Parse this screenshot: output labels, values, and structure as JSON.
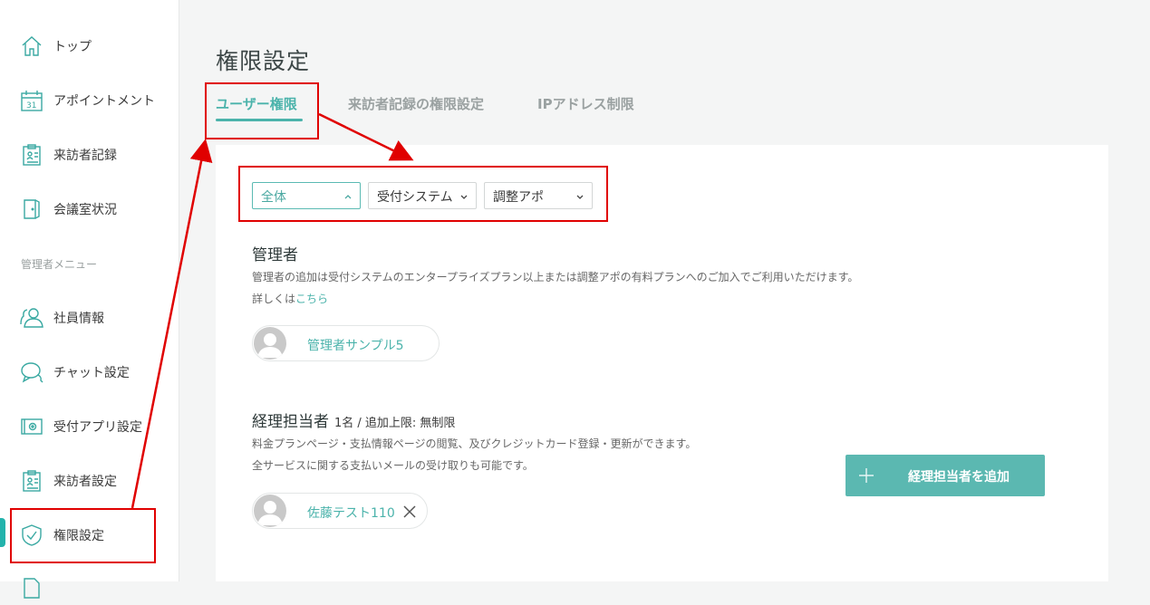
{
  "sidebar": {
    "items": [
      {
        "label": "トップ",
        "icon": "home-icon"
      },
      {
        "label": "アポイントメント",
        "icon": "calendar-icon"
      },
      {
        "label": "来訪者記録",
        "icon": "clipboard-icon"
      },
      {
        "label": "会議室状況",
        "icon": "door-icon"
      }
    ],
    "section_label": "管理者メニュー",
    "admin_items": [
      {
        "label": "社員情報",
        "icon": "users-icon"
      },
      {
        "label": "チャット設定",
        "icon": "chat-icon"
      },
      {
        "label": "受付アプリ設定",
        "icon": "tablet-gear-icon"
      },
      {
        "label": "来訪者設定",
        "icon": "clipboard-user-icon"
      },
      {
        "label": "権限設定",
        "icon": "shield-check-icon"
      }
    ]
  },
  "page": {
    "title": "権限設定",
    "tabs": [
      {
        "label": "ユーザー権限",
        "active": true
      },
      {
        "label": "来訪者記録の権限設定",
        "active": false
      },
      {
        "label": "IPアドレス制限",
        "active": false
      }
    ]
  },
  "filters": {
    "scope": "全体",
    "system": "受付システム",
    "app": "調整アポ"
  },
  "admin_section": {
    "title": "管理者",
    "description": "管理者の追加は受付システムのエンタープライズプラン以上または調整アポの有料プランへのご加入でご利用いただけます。",
    "more_prefix": "詳しくは",
    "more_link": "こちら",
    "members": [
      {
        "name": "管理者サンプル5"
      }
    ]
  },
  "accounting_section": {
    "title": "経理担当者",
    "count_info": "1名 / 追加上限: 無制限",
    "description_1": "料金プランページ・支払情報ページの閲覧、及びクレジットカード登録・更新ができます。",
    "description_2": "全サービスに関する支払いメールの受け取りも可能です。",
    "add_button": "経理担当者を追加",
    "members": [
      {
        "name": "佐藤テスト110"
      }
    ]
  },
  "colors": {
    "accent": "#4bb3ab",
    "button": "#5bb8b1",
    "annotation": "#e00000"
  }
}
